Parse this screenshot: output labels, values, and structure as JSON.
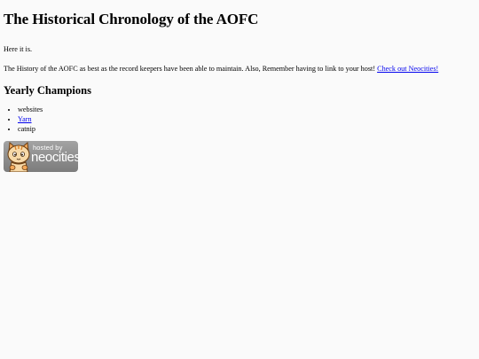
{
  "page": {
    "title": "The Historical Chronology of the AOFC",
    "intro": "Here it is.",
    "body_text": "The History of the AOFC as best as the record keepers have been able to maintain. Also, Remember having to link to your host!",
    "host_link": "Check out Neocities!"
  },
  "champions": {
    "heading": "Yearly Champions",
    "items": [
      {
        "label": "websites",
        "is_link": false
      },
      {
        "label": "Yarn",
        "is_link": true
      },
      {
        "label": "catnip",
        "is_link": false
      }
    ]
  },
  "badge": {
    "hosted_text": "hosted by",
    "brand_text": "neocities",
    "icon": "neocities-cat-icon"
  },
  "colors": {
    "link": "#0000ee",
    "background": "#fafafa",
    "badge": "#8f8f8f"
  }
}
